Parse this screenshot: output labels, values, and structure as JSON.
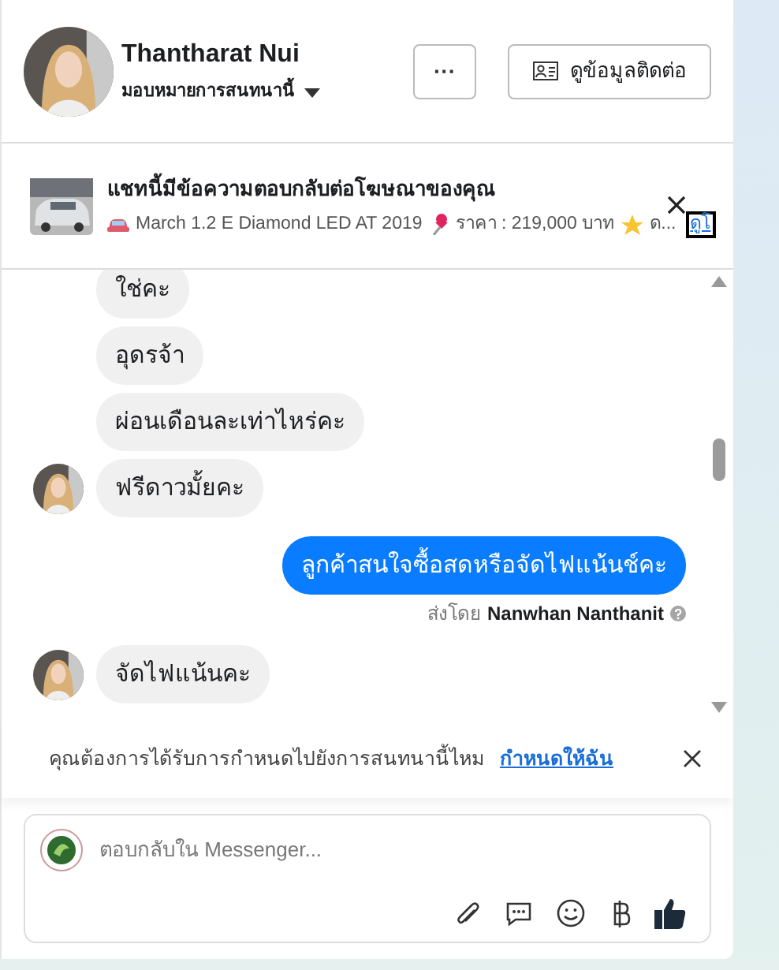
{
  "header": {
    "name": "Thantharat Nui",
    "assign_label": "มอบหมายการสนทนานี้",
    "more_button": "···",
    "contact_button": "ดูข้อมูลติดต่อ"
  },
  "ad_banner": {
    "title": "แชทนี้มีข้อความตอบกลับต่อโฆษณาของคุณ",
    "model": "March 1.2 E Diamond LED AT 2019",
    "price": "ราคา : 219,000 บาท",
    "more": "ด...",
    "link": "ดูโ"
  },
  "messages": [
    {
      "kind": "incoming",
      "text": "ใช่คะ",
      "show_avatar": false
    },
    {
      "kind": "incoming",
      "text": "อุดรจ้า",
      "show_avatar": false
    },
    {
      "kind": "incoming",
      "text": "ผ่อนเดือนละเท่าไหร่คะ",
      "show_avatar": false
    },
    {
      "kind": "incoming",
      "text": "ฟรีดาวมั้ยคะ",
      "show_avatar": true
    },
    {
      "kind": "outgoing",
      "text": "ลูกค้าสนใจซื้อสดหรือจัดไฟแน้นช์คะ",
      "sent_by_label": "ส่งโดย",
      "sent_by": "Nanwhan Nanthanit"
    },
    {
      "kind": "incoming",
      "text": "จัดไฟแน้นคะ",
      "show_avatar": true
    }
  ],
  "assign_prompt": {
    "text": "คุณต้องการได้รับการกำหนดไปยังการสนทนานี้ไหม",
    "link": "กำหนดให้ฉัน"
  },
  "composer": {
    "placeholder": "ตอบกลับใน Messenger..."
  }
}
